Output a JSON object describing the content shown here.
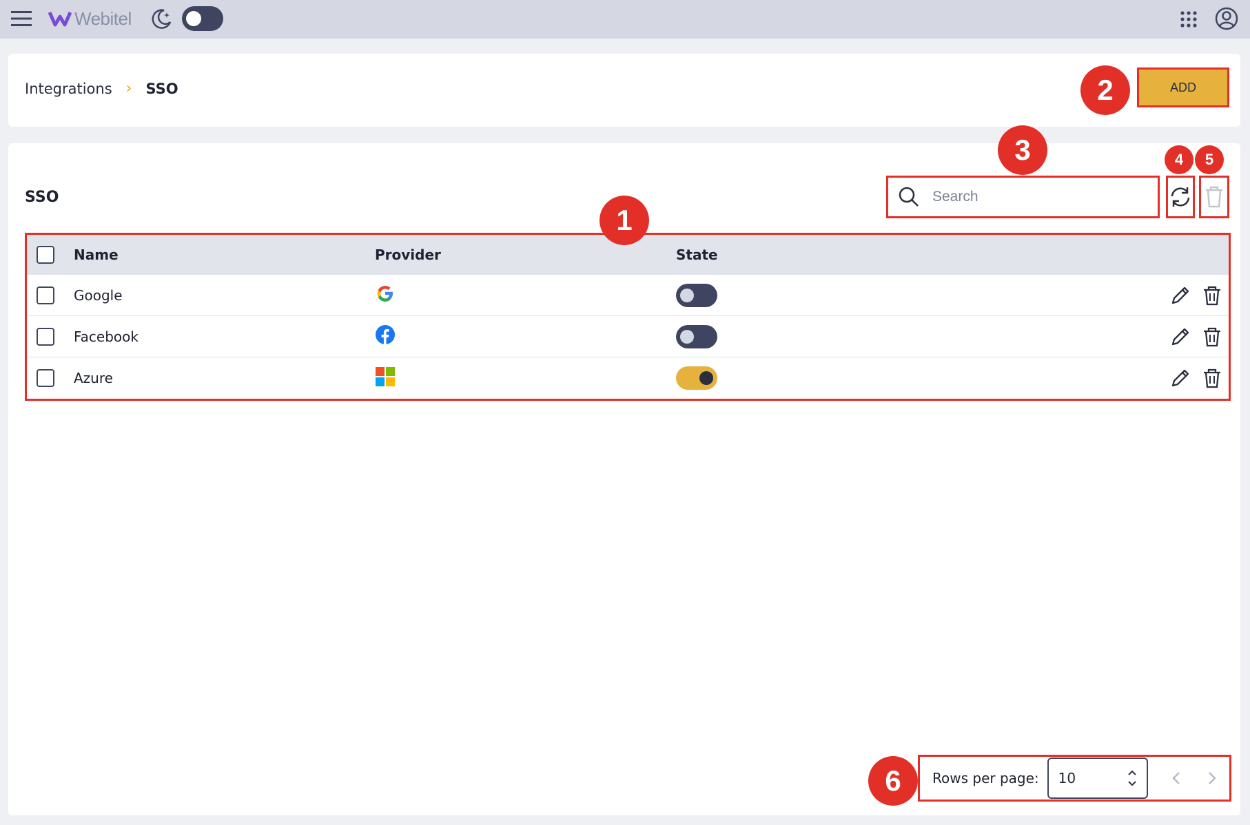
{
  "app": {
    "logo_text": "Webitel"
  },
  "breadcrumb": {
    "parent": "Integrations",
    "separator": "›",
    "current": "SSO"
  },
  "header": {
    "add_label": "ADD"
  },
  "section": {
    "title": "SSO"
  },
  "search": {
    "placeholder": "Search",
    "value": ""
  },
  "table": {
    "columns": [
      "Name",
      "Provider",
      "State"
    ],
    "rows": [
      {
        "name": "Google",
        "provider_icon": "google-icon",
        "state": false
      },
      {
        "name": "Facebook",
        "provider_icon": "facebook-icon",
        "state": false
      },
      {
        "name": "Azure",
        "provider_icon": "microsoft-icon",
        "state": true
      }
    ]
  },
  "pagination": {
    "rows_per_page_label": "Rows per page:",
    "rows_per_page": "10"
  },
  "annotations": [
    "1",
    "2",
    "3",
    "4",
    "5",
    "6"
  ],
  "colors": {
    "accent": "#e6b13d",
    "annotation": "#e23028",
    "toggle_off": "#3f4560",
    "topbar": "#d5d8e3"
  }
}
